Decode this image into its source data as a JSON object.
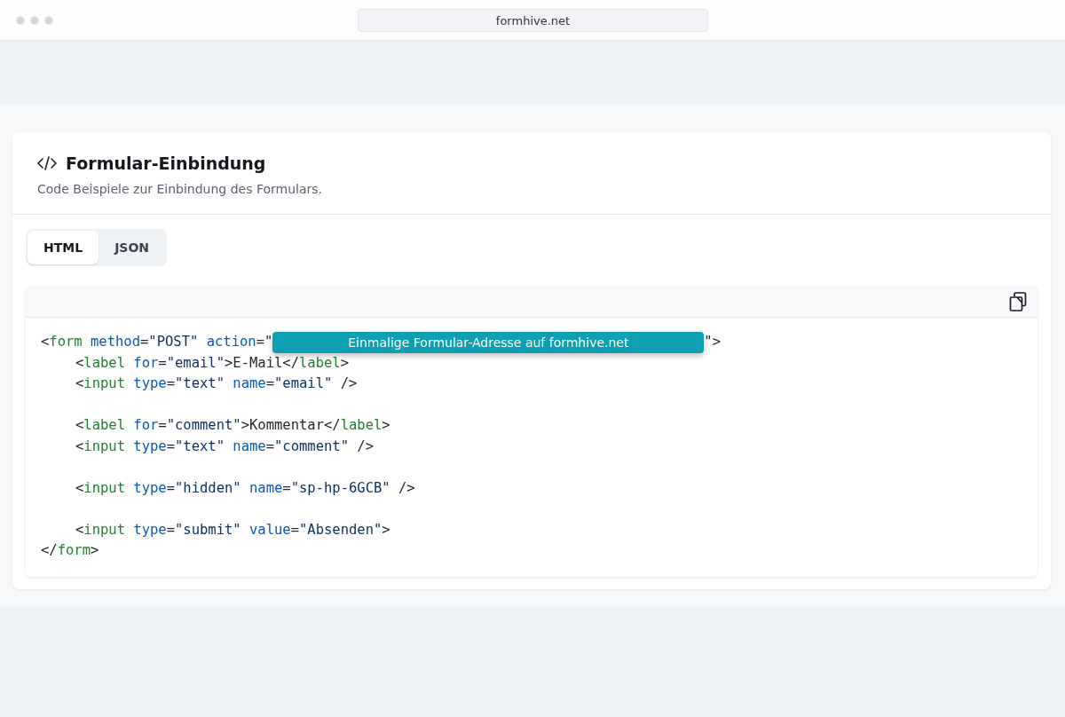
{
  "browser": {
    "url": "formhive.net"
  },
  "card": {
    "title": "Formular-Einbindung",
    "subtitle": "Code Beispiele zur Einbindung des Formulars."
  },
  "tabs": [
    {
      "label": "HTML",
      "selected": true
    },
    {
      "label": "JSON",
      "selected": false
    }
  ],
  "code": {
    "lines": [
      {
        "indent": false,
        "gap_before": false,
        "tokens": [
          {
            "kind": "p",
            "text": "<"
          },
          {
            "kind": "tag",
            "text": "form"
          },
          {
            "kind": "attr",
            "text": "method",
            "space": true
          },
          {
            "kind": "p",
            "text": "="
          },
          {
            "kind": "str",
            "text": "\"POST\""
          },
          {
            "kind": "attr",
            "text": "action",
            "space": true
          },
          {
            "kind": "p",
            "text": "=\""
          },
          {
            "kind": "overlay",
            "text": "Einmalige Formular-Adresse auf formhive.net"
          },
          {
            "kind": "p",
            "text": "\">"
          }
        ]
      },
      {
        "indent": true,
        "gap_before": false,
        "tokens": [
          {
            "kind": "p",
            "text": "<"
          },
          {
            "kind": "tag",
            "text": "label"
          },
          {
            "kind": "attr",
            "text": "for",
            "space": true
          },
          {
            "kind": "p",
            "text": "="
          },
          {
            "kind": "str",
            "text": "\"email\""
          },
          {
            "kind": "p",
            "text": ">E-Mail</"
          },
          {
            "kind": "tag",
            "text": "label"
          },
          {
            "kind": "p",
            "text": ">"
          }
        ]
      },
      {
        "indent": true,
        "gap_before": false,
        "tokens": [
          {
            "kind": "p",
            "text": "<"
          },
          {
            "kind": "tag",
            "text": "input"
          },
          {
            "kind": "attr",
            "text": "type",
            "space": true
          },
          {
            "kind": "p",
            "text": "="
          },
          {
            "kind": "str",
            "text": "\"text\""
          },
          {
            "kind": "attr",
            "text": "name",
            "space": true
          },
          {
            "kind": "p",
            "text": "="
          },
          {
            "kind": "str",
            "text": "\"email\""
          },
          {
            "kind": "p",
            "text": " />"
          }
        ]
      },
      {
        "indent": true,
        "gap_before": true,
        "tokens": [
          {
            "kind": "p",
            "text": "<"
          },
          {
            "kind": "tag",
            "text": "label"
          },
          {
            "kind": "attr",
            "text": "for",
            "space": true
          },
          {
            "kind": "p",
            "text": "="
          },
          {
            "kind": "str",
            "text": "\"comment\""
          },
          {
            "kind": "p",
            "text": ">Kommentar</"
          },
          {
            "kind": "tag",
            "text": "label"
          },
          {
            "kind": "p",
            "text": ">"
          }
        ]
      },
      {
        "indent": true,
        "gap_before": false,
        "tokens": [
          {
            "kind": "p",
            "text": "<"
          },
          {
            "kind": "tag",
            "text": "input"
          },
          {
            "kind": "attr",
            "text": "type",
            "space": true
          },
          {
            "kind": "p",
            "text": "="
          },
          {
            "kind": "str",
            "text": "\"text\""
          },
          {
            "kind": "attr",
            "text": "name",
            "space": true
          },
          {
            "kind": "p",
            "text": "="
          },
          {
            "kind": "str",
            "text": "\"comment\""
          },
          {
            "kind": "p",
            "text": " />"
          }
        ]
      },
      {
        "indent": true,
        "gap_before": true,
        "tokens": [
          {
            "kind": "p",
            "text": "<"
          },
          {
            "kind": "tag",
            "text": "input"
          },
          {
            "kind": "attr",
            "text": "type",
            "space": true
          },
          {
            "kind": "p",
            "text": "="
          },
          {
            "kind": "str",
            "text": "\"hidden\""
          },
          {
            "kind": "attr",
            "text": "name",
            "space": true
          },
          {
            "kind": "p",
            "text": "="
          },
          {
            "kind": "str",
            "text": "\"sp-hp-6GCB\""
          },
          {
            "kind": "p",
            "text": " />"
          }
        ]
      },
      {
        "indent": true,
        "gap_before": true,
        "tokens": [
          {
            "kind": "p",
            "text": "<"
          },
          {
            "kind": "tag",
            "text": "input"
          },
          {
            "kind": "attr",
            "text": "type",
            "space": true
          },
          {
            "kind": "p",
            "text": "="
          },
          {
            "kind": "str",
            "text": "\"submit\""
          },
          {
            "kind": "attr",
            "text": "value",
            "space": true
          },
          {
            "kind": "p",
            "text": "="
          },
          {
            "kind": "str",
            "text": "\"Absenden\""
          },
          {
            "kind": "p",
            "text": ">"
          }
        ]
      },
      {
        "indent": false,
        "gap_before": false,
        "tokens": [
          {
            "kind": "p",
            "text": "</"
          },
          {
            "kind": "tag",
            "text": "form"
          },
          {
            "kind": "p",
            "text": ">"
          }
        ]
      }
    ]
  }
}
